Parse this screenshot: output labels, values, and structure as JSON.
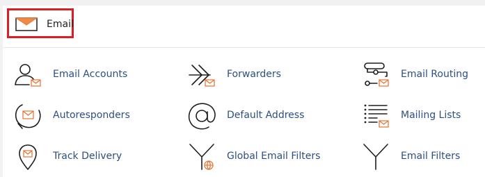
{
  "section": {
    "title": "Email",
    "icon": "envelope-icon",
    "accent_color": "#e8773a",
    "highlight_color": "#d91e26"
  },
  "items": [
    {
      "label": "Email Accounts",
      "icon": "email-accounts-icon"
    },
    {
      "label": "Forwarders",
      "icon": "forwarders-icon"
    },
    {
      "label": "Email Routing",
      "icon": "email-routing-icon"
    },
    {
      "label": "Autoresponders",
      "icon": "autoresponders-icon"
    },
    {
      "label": "Default Address",
      "icon": "default-address-icon"
    },
    {
      "label": "Mailing Lists",
      "icon": "mailing-lists-icon"
    },
    {
      "label": "Track Delivery",
      "icon": "track-delivery-icon"
    },
    {
      "label": "Global Email Filters",
      "icon": "global-email-filters-icon"
    },
    {
      "label": "Email Filters",
      "icon": "email-filters-icon"
    }
  ]
}
